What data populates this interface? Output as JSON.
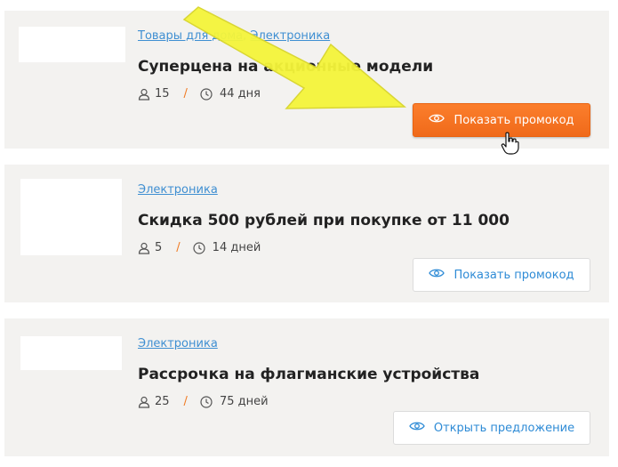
{
  "offers": [
    {
      "categories": [
        "Товары для дома",
        "Электроника"
      ],
      "category_separator": ",",
      "title": "Суперцена на акционные модели",
      "uses": "15",
      "days": "44 дня",
      "button_label": "Показать промокод",
      "button_style": "primary"
    },
    {
      "categories": [
        "Электроника"
      ],
      "title": "Скидка 500 рублей при покупке от 11 000",
      "uses": "5",
      "days": "14 дней",
      "button_label": "Показать промокод",
      "button_style": "secondary"
    },
    {
      "categories": [
        "Электроника"
      ],
      "title": "Рассрочка на флагманские устройства",
      "uses": "25",
      "days": "75 дней",
      "button_label": "Открыть предложение",
      "button_style": "secondary"
    }
  ],
  "meta_separator": "/",
  "colors": {
    "accent_orange": "#f47524",
    "link_blue": "#3f8fd2",
    "card_bg": "#f3f2f0",
    "annotation_arrow": "#f5f53a"
  },
  "icons": {
    "users": "user-icon",
    "time": "clock-icon",
    "button": "eye-icon",
    "annotation": "yellow-arrow-icon",
    "pointer": "hand-cursor-icon"
  }
}
